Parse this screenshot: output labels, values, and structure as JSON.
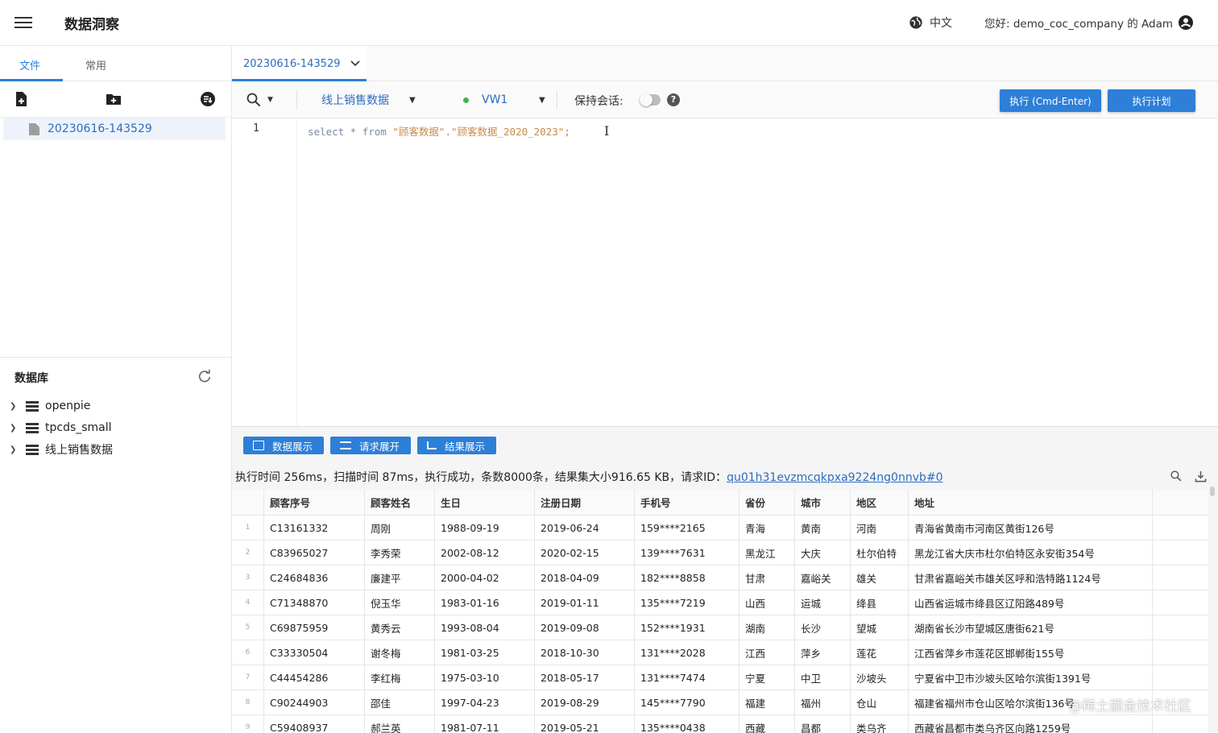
{
  "app": {
    "title": "数据洞察"
  },
  "header": {
    "language": "中文",
    "greeting": "您好: demo_coc_company 的 Adam"
  },
  "sidebar": {
    "tabs": [
      "文件",
      "常用"
    ],
    "active_file": "20230616-143529",
    "db_title": "数据库",
    "databases": [
      "openpie",
      "tpcds_small",
      "线上销售数据"
    ]
  },
  "editor_tab": {
    "label": "20230616-143529"
  },
  "toolbar": {
    "database_select": "线上销售数据",
    "warehouse_select": "VW1",
    "keep_session_label": "保持会话:",
    "help": "?",
    "run_label": "执行 (Cmd-Enter)",
    "plan_label": "执行计划"
  },
  "editor": {
    "line_number": "1",
    "code_kw1": "select",
    "code_mid": " * ",
    "code_kw2": "from",
    "code_str1": "\"顾客数据\"",
    "code_dot": ".",
    "code_str2": "\"顾客数据_2020_2023\"",
    "code_end": ";",
    "cursor": "I"
  },
  "results": {
    "buttons": [
      "数据展示",
      "请求展开",
      "结果展示"
    ],
    "status_text": "执行时间 256ms，扫描时间 87ms，执行成功，条数8000条，结果集大小916.65 KB，请求ID：",
    "request_id": "qu01h31evzmcqkpxa9224ng0nnvb#0",
    "columns": [
      "顾客序号",
      "顾客姓名",
      "生日",
      "注册日期",
      "手机号",
      "省份",
      "城市",
      "地区",
      "地址"
    ],
    "rows": [
      [
        "1",
        "C13161332",
        "周刚",
        "1988-09-19",
        "2019-06-24",
        "159****2165",
        "青海",
        "黄南",
        "河南",
        "青海省黄南市河南区黄街126号"
      ],
      [
        "2",
        "C83965027",
        "李秀荣",
        "2002-08-12",
        "2020-02-15",
        "139****7631",
        "黑龙江",
        "大庆",
        "杜尔伯特",
        "黑龙江省大庆市杜尔伯特区永安街354号"
      ],
      [
        "3",
        "C24684836",
        "廉建平",
        "2000-04-02",
        "2018-04-09",
        "182****8858",
        "甘肃",
        "嘉峪关",
        "雄关",
        "甘肃省嘉峪关市雄关区呼和浩特路1124号"
      ],
      [
        "4",
        "C71348870",
        "倪玉华",
        "1983-01-16",
        "2019-01-11",
        "135****7219",
        "山西",
        "运城",
        "绛县",
        "山西省运城市绛县区辽阳路489号"
      ],
      [
        "5",
        "C69875959",
        "黄秀云",
        "1993-08-04",
        "2019-09-08",
        "152****1931",
        "湖南",
        "长沙",
        "望城",
        "湖南省长沙市望城区唐街621号"
      ],
      [
        "6",
        "C33330504",
        "谢冬梅",
        "1981-03-25",
        "2018-10-30",
        "131****2028",
        "江西",
        "萍乡",
        "莲花",
        "江西省萍乡市莲花区邯郸街155号"
      ],
      [
        "7",
        "C44454286",
        "李红梅",
        "1975-03-10",
        "2018-05-17",
        "131****7474",
        "宁夏",
        "中卫",
        "沙坡头",
        "宁夏省中卫市沙坡头区哈尔滨街1391号"
      ],
      [
        "8",
        "C90244903",
        "邵佳",
        "1997-04-23",
        "2019-08-29",
        "145****7790",
        "福建",
        "福州",
        "仓山",
        "福建省福州市仓山区哈尔滨街136号"
      ],
      [
        "9",
        "C59408937",
        "郝兰英",
        "1981-07-11",
        "2019-05-21",
        "135****0438",
        "西藏",
        "昌都",
        "类乌齐",
        "西藏省昌都市类乌齐区向路1259号"
      ]
    ]
  },
  "watermark": "@稀土掘金技术社区"
}
